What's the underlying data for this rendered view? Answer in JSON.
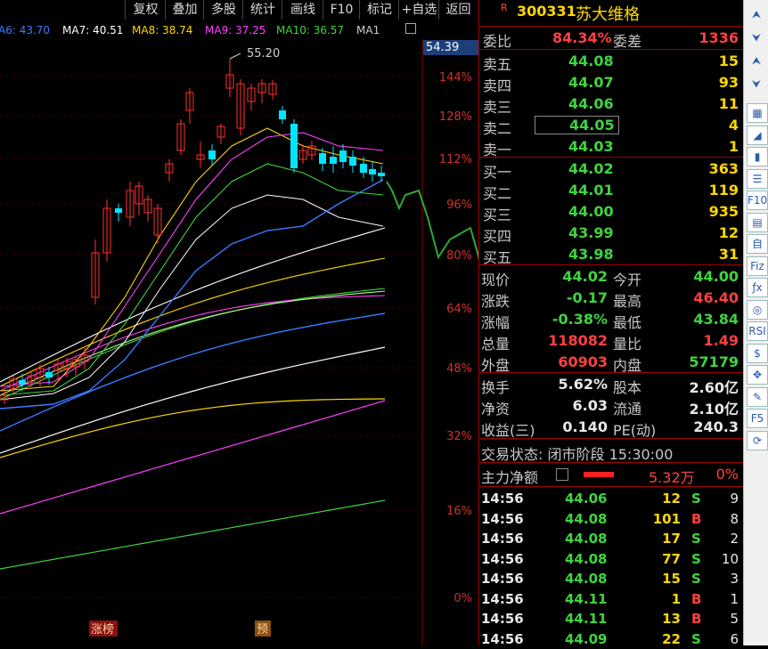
{
  "toolbar": {
    "buttons": [
      "复权",
      "叠加",
      "多股",
      "统计",
      "画线",
      "F10",
      "标记",
      "+自选",
      "返回"
    ]
  },
  "ma_legend": [
    {
      "label": "A6: 43.70",
      "color": "#3a7bff"
    },
    {
      "label": "MA7: 40.51",
      "color": "#ffffff"
    },
    {
      "label": "MA8: 38.74",
      "color": "#ffd700"
    },
    {
      "label": "MA9: 37.25",
      "color": "#ff40ff"
    },
    {
      "label": "MA10: 36.57",
      "color": "#3fd43f"
    },
    {
      "label": "MA1",
      "color": "#cccccc"
    }
  ],
  "chart": {
    "current_price": "54.39",
    "peak_label": "55.20",
    "pct_ticks": [
      "144%",
      "128%",
      "112%",
      "96%",
      "80%",
      "64%",
      "48%",
      "32%",
      "16%",
      "0%"
    ],
    "markers": [
      "涨榜",
      "预"
    ],
    "colors": {
      "up": "#ff3030",
      "down": "#00e5ff",
      "grid": "#6a0000",
      "forecast": "#2ea832"
    }
  },
  "stock": {
    "flag": "R",
    "code": "300331",
    "name": "苏大维格"
  },
  "ratio": {
    "label1": "委比",
    "value1": "84.34%",
    "label2": "委差",
    "value2": "1336"
  },
  "asks": [
    {
      "label": "卖五",
      "price": "44.08",
      "vol": "15"
    },
    {
      "label": "卖四",
      "price": "44.07",
      "vol": "93"
    },
    {
      "label": "卖三",
      "price": "44.06",
      "vol": "11"
    },
    {
      "label": "卖二",
      "price": "44.05",
      "vol": "4"
    },
    {
      "label": "卖一",
      "price": "44.03",
      "vol": "1"
    }
  ],
  "bids": [
    {
      "label": "买一",
      "price": "44.02",
      "vol": "363"
    },
    {
      "label": "买二",
      "price": "44.01",
      "vol": "119"
    },
    {
      "label": "买三",
      "price": "44.00",
      "vol": "935"
    },
    {
      "label": "买四",
      "price": "43.99",
      "vol": "12"
    },
    {
      "label": "买五",
      "price": "43.98",
      "vol": "31"
    }
  ],
  "quote": [
    {
      "l1": "现价",
      "v1": "44.02",
      "l2": "今开",
      "v2": "44.00"
    },
    {
      "l1": "涨跌",
      "v1": "-0.17",
      "l2": "最高",
      "v2": "46.40"
    },
    {
      "l1": "涨幅",
      "v1": "-0.38%",
      "l2": "最低",
      "v2": "43.84"
    },
    {
      "l1": "总量",
      "v1": "118082",
      "l2": "量比",
      "v2": "1.49"
    },
    {
      "l1": "外盘",
      "v1": "60903",
      "l2": "内盘",
      "v2": "57179"
    }
  ],
  "fundamentals": [
    {
      "l1": "换手",
      "v1": "5.62%",
      "l2": "股本",
      "v2": "2.60亿"
    },
    {
      "l1": "净资",
      "v1": "6.03",
      "l2": "流通",
      "v2": "2.10亿"
    },
    {
      "l1": "收益(三)",
      "v1": "0.140",
      "l2": "PE(动)",
      "v2": "240.3"
    }
  ],
  "status": {
    "text": "交易状态: 闭市阶段 15:30:00"
  },
  "capital": {
    "label": "主力净额",
    "value": "5.32万",
    "pct": "0%"
  },
  "ticks": [
    {
      "time": "14:56",
      "price": "44.06",
      "vol": "12",
      "side": "S",
      "n": "9"
    },
    {
      "time": "14:56",
      "price": "44.08",
      "vol": "101",
      "side": "B",
      "n": "8"
    },
    {
      "time": "14:56",
      "price": "44.08",
      "vol": "17",
      "side": "S",
      "n": "2"
    },
    {
      "time": "14:56",
      "price": "44.08",
      "vol": "77",
      "side": "S",
      "n": "10"
    },
    {
      "time": "14:56",
      "price": "44.08",
      "vol": "15",
      "side": "S",
      "n": "3"
    },
    {
      "time": "14:56",
      "price": "44.11",
      "vol": "1",
      "side": "B",
      "n": "1"
    },
    {
      "time": "14:56",
      "price": "44.11",
      "vol": "13",
      "side": "B",
      "n": "5"
    },
    {
      "time": "14:56",
      "price": "44.09",
      "vol": "22",
      "side": "S",
      "n": "6"
    }
  ],
  "side_icons": [
    "up-arrow-icon",
    "down-arrow-icon",
    "up-arrow-icon",
    "down-arrow-icon",
    "table-icon",
    "chart-icon",
    "candle-icon",
    "list-icon",
    "f10-icon",
    "doc-icon",
    "self-icon",
    "fiz-icon",
    "formula-icon",
    "circle-icon",
    "rsi-icon",
    "money-icon",
    "move-icon",
    "pen-icon",
    "f5-icon",
    "refresh-icon"
  ]
}
